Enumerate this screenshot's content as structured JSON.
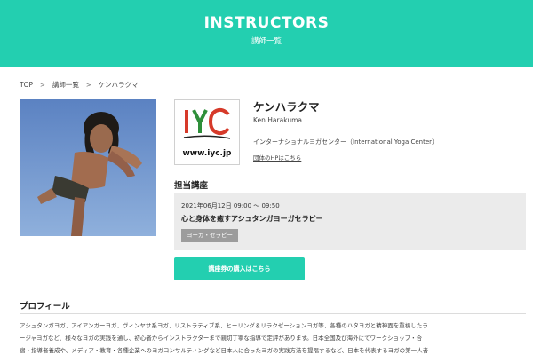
{
  "hero": {
    "title": "INSTRUCTORS",
    "subtitle": "講師一覧"
  },
  "breadcrumb": {
    "items": [
      "TOP",
      "講師一覧",
      "ケンハラクマ"
    ],
    "separator": ">"
  },
  "instructor": {
    "name": "ケンハラクマ",
    "name_en": "Ken Harakuma",
    "organization": "インターナショナルヨガセンター（International Yoga Center）",
    "hp_link": "団体のHPはこちら",
    "logo": {
      "letters": "IYC",
      "url_text": "www.iyc.jp"
    }
  },
  "courses": {
    "heading": "担当講座",
    "items": [
      {
        "date": "2021年06月12日 09:00 〜 09:50",
        "title": "心と身体を癒すアシュタンガヨーガセラピー",
        "tag": "ヨーガ・セラピー"
      }
    ]
  },
  "cta": {
    "label": "講座券の購入はこちら"
  },
  "profile": {
    "heading": "プロフィール",
    "lines": [
      "アシュタンガヨガ、アイアンガーヨガ、ヴィンヤサ系ヨガ、リストラティブ系、ヒーリング＆リラクゼーションヨガ等、各種のハタヨガと精神面を重視したラ",
      "ージャヨガなど、様々なヨガの実践を通し、初心者からインストラクターまで親切丁寧な指導で定評があります。日本全国及び海外にてワークショップ・合",
      "宿・指導者養成や、メディア・教育・各種企業へのヨガコンサルティングなど日本人に合ったヨガの実践方法を提唱するなど、日本を代表するヨガの第一人者"
    ]
  },
  "colors": {
    "accent": "#23cfb0",
    "tag_bg": "#9c9c9c",
    "course_box_bg": "#ebebeb",
    "logo_red": "#d63a2a",
    "logo_green": "#2e8f3a"
  }
}
